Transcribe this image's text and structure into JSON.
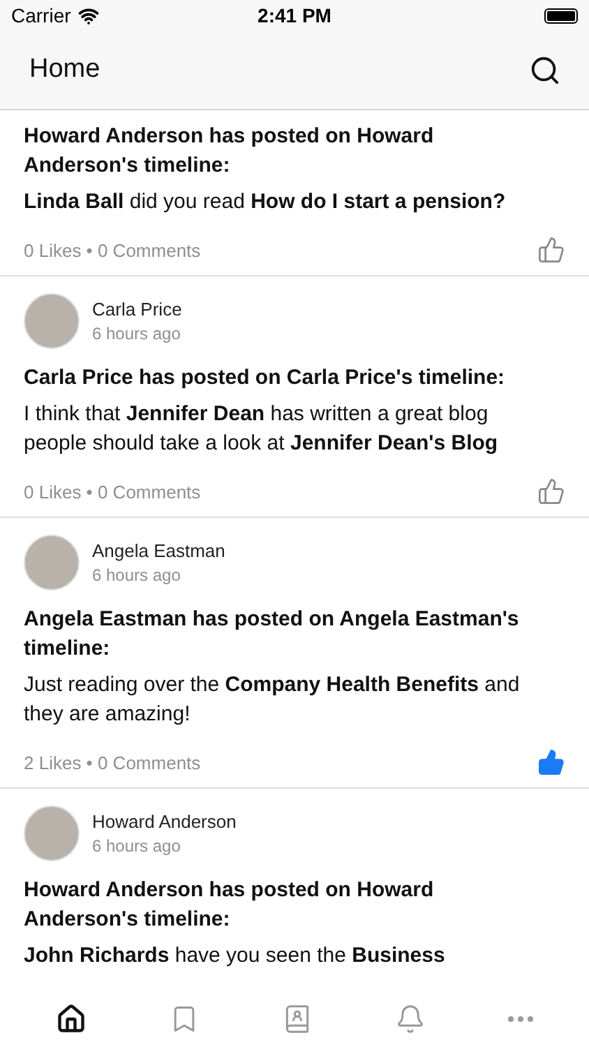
{
  "status_bar": {
    "carrier": "Carrier",
    "time": "2:41 PM"
  },
  "nav_bar": {
    "title": "Home"
  },
  "posts": [
    {
      "title": "Howard Anderson has posted on Howard Anderson's timeline:",
      "body": "**Linda Ball** did you read **How do I start a pension?**",
      "stats": "0 Likes • 0 Comments",
      "liked": false
    },
    {
      "author": "Carla Price",
      "time": "6 hours ago",
      "title": "Carla Price has posted on Carla Price's timeline:",
      "body": "I think that **Jennifer Dean** has written a great blog people should take a look at **Jennifer Dean's Blog**",
      "stats": "0 Likes • 0 Comments",
      "liked": false
    },
    {
      "author": "Angela Eastman",
      "time": "6 hours ago",
      "title": "Angela Eastman has posted on Angela Eastman's timeline:",
      "body": "Just reading over the **Company Health Benefits** and they are amazing!",
      "stats": "2 Likes • 0 Comments",
      "liked": true
    },
    {
      "author": "Howard Anderson",
      "time": "6 hours ago",
      "title": "Howard Anderson has posted on Howard Anderson's timeline:",
      "body": "**John Richards** have you seen the **Business**"
    }
  ],
  "tab_bar": [
    {
      "kind": "home",
      "selected": true
    },
    {
      "kind": "bookmark",
      "selected": false
    },
    {
      "kind": "contacts",
      "selected": false
    },
    {
      "kind": "bell",
      "selected": false
    },
    {
      "kind": "more",
      "selected": false
    }
  ]
}
